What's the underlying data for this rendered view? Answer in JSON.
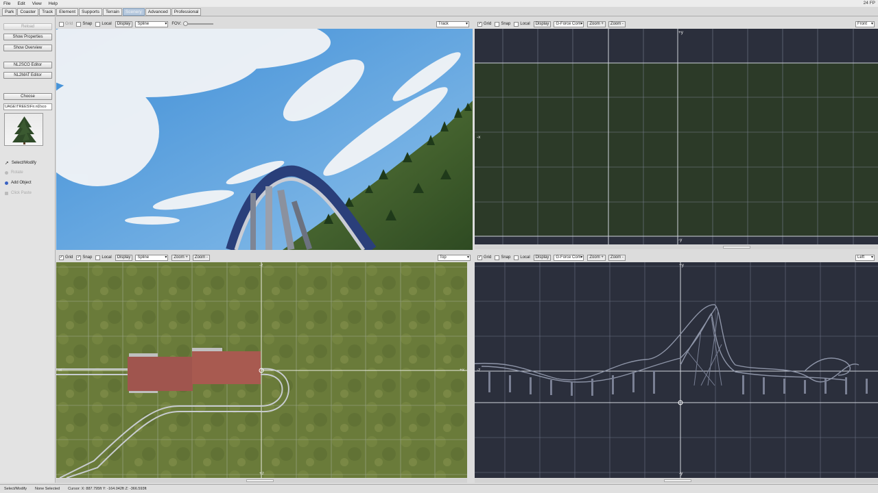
{
  "menu": {
    "file": "File",
    "edit": "Edit",
    "view": "View",
    "help": "Help"
  },
  "fps": "24 FP",
  "tabs": [
    "Park",
    "Coaster",
    "Track",
    "Element",
    "Supports",
    "Terrain",
    "Scenery",
    "Advanced",
    "Professional"
  ],
  "active_tab": "Scenery",
  "left": {
    "reload": "Reload",
    "show_properties": "Show Properties",
    "show_overview": "Show Overview",
    "nl2sco_editor": "NL2SCO Editor",
    "nl2mat_editor": "NL2MAT Editor",
    "choose": "Choose",
    "path": "UAGE\\TREES\\Fir.nl2sco",
    "tools": [
      "Select/Modify",
      "Rotate",
      "Add Object",
      "Click Paste"
    ]
  },
  "vp1": {
    "grid": "Grid",
    "snap": "Snap",
    "local": "Local",
    "display": "Display",
    "mode": "Spline",
    "fov": "FOV:",
    "camera": "Track"
  },
  "vp2": {
    "grid": "Grid",
    "snap": "Snap",
    "local": "Local",
    "display": "Display",
    "mode": "G-Force Com",
    "zoom_in": "Zoom +",
    "zoom_out": "Zoom -",
    "view": "Front",
    "axis_top": "+y",
    "axis_bottom": "-y",
    "axis_left": "-x"
  },
  "vp3": {
    "grid": "Grid",
    "snap": "Snap",
    "local": "Local",
    "display": "Display",
    "mode": "Spline",
    "zoom_in": "Zoom +",
    "zoom_out": "Zoom -",
    "view": "Top",
    "axis_top": "-z",
    "axis_bottom": "+z",
    "axis_left": "-x",
    "axis_right": "+x"
  },
  "vp4": {
    "grid": "Grid",
    "snap": "Snap",
    "local": "Local",
    "display": "Display",
    "mode": "G-Force Com",
    "zoom_in": "Zoom +",
    "zoom_out": "Zoom -",
    "view": "Left",
    "axis_top": "+y",
    "axis_bottom": "-y",
    "axis_left": "-z"
  },
  "status": {
    "mode": "Select/Modify",
    "selection": "None Selected",
    "cursor": "Cursor: X: 887.795ft Y: -164.042ft Z: -366.593ft"
  }
}
